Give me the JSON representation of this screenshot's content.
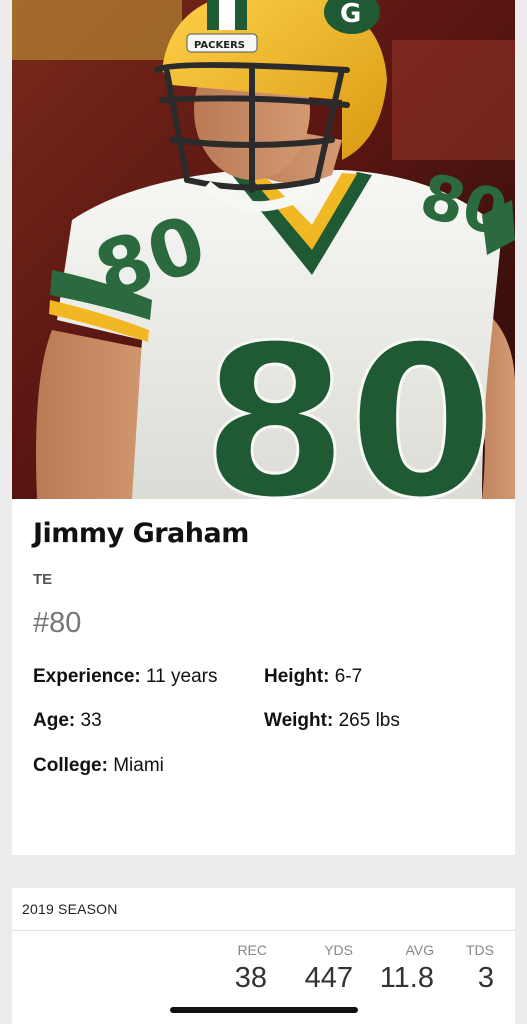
{
  "player": {
    "name": "Jimmy Graham",
    "position": "TE",
    "number": "#80",
    "jersey_digits": "80",
    "helmet_text": "PACKERS",
    "bio": {
      "experience_label": "Experience:",
      "experience_value": "11 years",
      "height_label": "Height:",
      "height_value": "6-7",
      "age_label": "Age:",
      "age_value": "33",
      "weight_label": "Weight:",
      "weight_value": "265 lbs",
      "college_label": "College:",
      "college_value": "Miami"
    }
  },
  "season": {
    "title": "2019 SEASON",
    "stats": [
      {
        "label": "REC",
        "value": "38"
      },
      {
        "label": "YDS",
        "value": "447"
      },
      {
        "label": "AVG",
        "value": "11.8"
      },
      {
        "label": "TDS",
        "value": "3"
      }
    ]
  },
  "colors": {
    "jersey_green": "#1f5a34",
    "helmet_gold": "#f2b823",
    "background": "#ececec"
  }
}
